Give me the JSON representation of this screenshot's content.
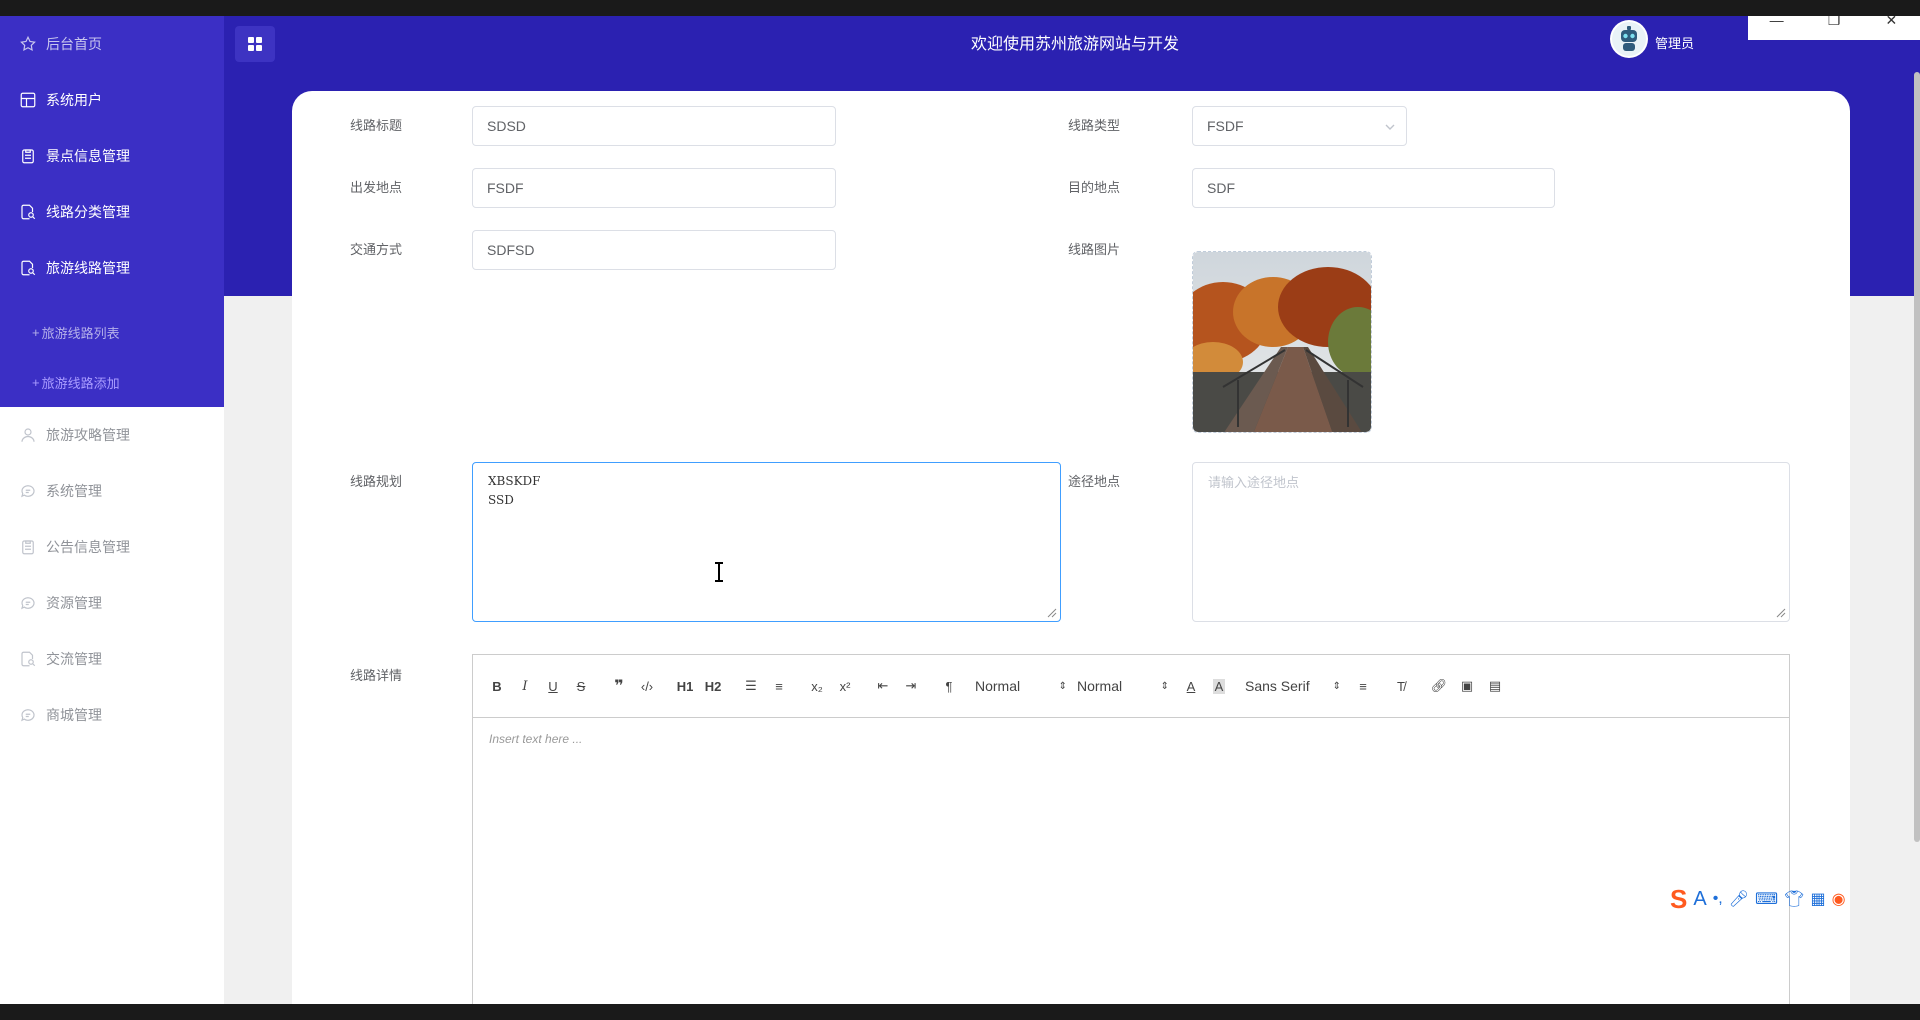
{
  "header": {
    "title": "欢迎使用苏州旅游网站与开发",
    "user": "管理员"
  },
  "sidebar": {
    "items": [
      {
        "label": "后台首页",
        "icon": "star-icon"
      },
      {
        "label": "系统用户",
        "icon": "grid-icon"
      },
      {
        "label": "景点信息管理",
        "icon": "clipboard-icon"
      },
      {
        "label": "线路分类管理",
        "icon": "doc-search-icon"
      },
      {
        "label": "旅游线路管理",
        "icon": "doc-search-icon"
      },
      {
        "label": "旅游攻略管理",
        "icon": "user-icon"
      },
      {
        "label": "系统管理",
        "icon": "chat-icon"
      },
      {
        "label": "公告信息管理",
        "icon": "clipboard-icon"
      },
      {
        "label": "资源管理",
        "icon": "chat-icon"
      },
      {
        "label": "交流管理",
        "icon": "doc-search-icon"
      },
      {
        "label": "商城管理",
        "icon": "chat-icon"
      }
    ],
    "subitems": [
      {
        "label": "旅游线路列表"
      },
      {
        "label": "旅游线路添加"
      }
    ]
  },
  "form": {
    "route_title": {
      "label": "线路标题",
      "value": "SDSD"
    },
    "route_type": {
      "label": "线路类型",
      "value": "FSDF"
    },
    "departure": {
      "label": "出发地点",
      "value": "FSDF"
    },
    "destination": {
      "label": "目的地点",
      "value": "SDF"
    },
    "transport": {
      "label": "交通方式",
      "value": "SDFSD"
    },
    "route_image": {
      "label": "线路图片"
    },
    "route_plan": {
      "label": "线路规划",
      "value": "XBSKDF\nSSD"
    },
    "waypoints": {
      "label": "途径地点",
      "placeholder": "请输入途径地点"
    },
    "route_detail": {
      "label": "线路详情",
      "placeholder": "Insert text here ..."
    }
  },
  "toolbar": {
    "header_size": "Normal",
    "text_size": "Normal",
    "font": "Sans Serif",
    "h1": "H1",
    "h2": "H2"
  }
}
